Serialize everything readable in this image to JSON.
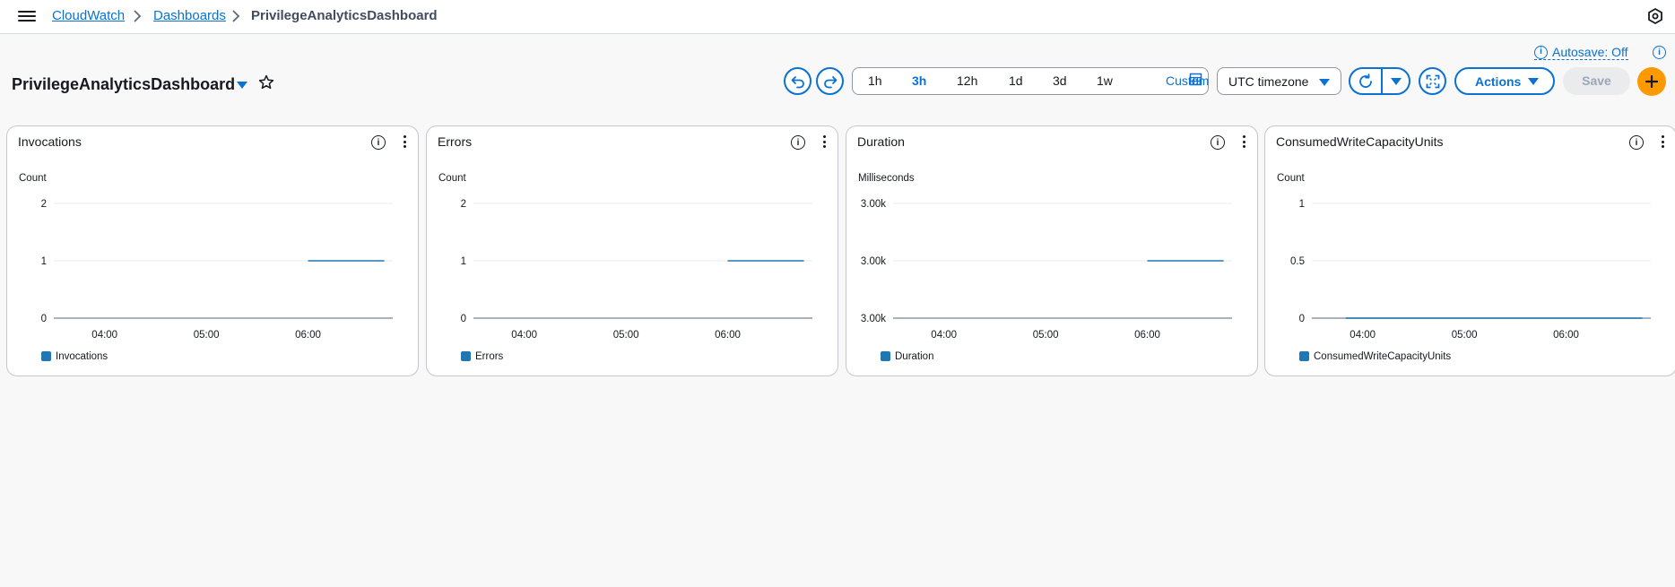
{
  "breadcrumb": {
    "items": [
      "CloudWatch",
      "Dashboards"
    ],
    "current": "PrivilegeAnalyticsDashboard"
  },
  "header": {
    "title": "PrivilegeAnalyticsDashboard",
    "autosave_label": "Autosave: Off",
    "time_ranges": [
      "1h",
      "3h",
      "12h",
      "1d",
      "3d",
      "1w"
    ],
    "active_range": "3h",
    "custom_label": "Custom",
    "timezone": "UTC timezone",
    "actions_label": "Actions",
    "save_label": "Save"
  },
  "colors": {
    "accent": "#0972d3",
    "series": "#1f77b4",
    "add_button": "#ff9900"
  },
  "widgets": [
    {
      "title": "Invocations",
      "unit": "Count",
      "legend": "Invocations",
      "y_ticks": [
        "2",
        "1",
        "0"
      ],
      "x_ticks": [
        "04:00",
        "05:00",
        "06:00"
      ]
    },
    {
      "title": "Errors",
      "unit": "Count",
      "legend": "Errors",
      "y_ticks": [
        "2",
        "1",
        "0"
      ],
      "x_ticks": [
        "04:00",
        "05:00",
        "06:00"
      ]
    },
    {
      "title": "Duration",
      "unit": "Milliseconds",
      "legend": "Duration",
      "y_ticks": [
        "3.00k",
        "3.00k",
        "3.00k"
      ],
      "x_ticks": [
        "04:00",
        "05:00",
        "06:00"
      ]
    },
    {
      "title": "ConsumedWriteCapacityUnits",
      "unit": "Count",
      "legend": "ConsumedWriteCapacityUnits",
      "y_ticks": [
        "1",
        "0.5",
        "0"
      ],
      "x_ticks": [
        "04:00",
        "05:00",
        "06:00"
      ]
    }
  ],
  "chart_data": [
    {
      "type": "line",
      "title": "Invocations",
      "ylabel": "Count",
      "ylim": [
        0,
        2
      ],
      "x_ticks": [
        "04:00",
        "05:00",
        "06:00"
      ],
      "series": [
        {
          "name": "Invocations",
          "x": [
            "06:00",
            "06:45"
          ],
          "values": [
            1,
            1
          ]
        }
      ]
    },
    {
      "type": "line",
      "title": "Errors",
      "ylabel": "Count",
      "ylim": [
        0,
        2
      ],
      "x_ticks": [
        "04:00",
        "05:00",
        "06:00"
      ],
      "series": [
        {
          "name": "Errors",
          "x": [
            "06:00",
            "06:45"
          ],
          "values": [
            1,
            1
          ]
        }
      ]
    },
    {
      "type": "line",
      "title": "Duration",
      "ylabel": "Milliseconds",
      "x_ticks": [
        "04:00",
        "05:00",
        "06:00"
      ],
      "series": [
        {
          "name": "Duration",
          "x": [
            "06:00",
            "06:45"
          ],
          "values": [
            3000,
            3000
          ]
        }
      ]
    },
    {
      "type": "line",
      "title": "ConsumedWriteCapacityUnits",
      "ylabel": "Count",
      "ylim": [
        0,
        1
      ],
      "x_ticks": [
        "04:00",
        "05:00",
        "06:00"
      ],
      "series": [
        {
          "name": "ConsumedWriteCapacityUnits",
          "x": [
            "03:50",
            "06:45"
          ],
          "values": [
            0,
            0
          ]
        }
      ]
    }
  ]
}
